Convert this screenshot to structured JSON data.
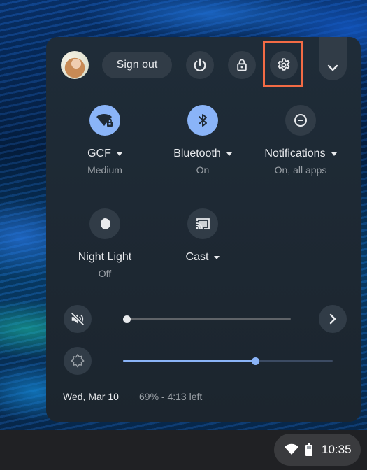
{
  "top_row": {
    "avatar_alt": "User avatar",
    "sign_out_label": "Sign out",
    "power_icon": "power-icon",
    "lock_icon": "lock-icon",
    "settings_icon": "gear-icon",
    "collapse_icon": "chevron-down-icon"
  },
  "tiles": [
    {
      "label": "GCF",
      "sub": "Medium",
      "icon": "wifi-lock-icon",
      "active": true,
      "has_menu": true
    },
    {
      "label": "Bluetooth",
      "sub": "On",
      "icon": "bluetooth-icon",
      "active": true,
      "has_menu": true
    },
    {
      "label": "Notifications",
      "sub": "On, all apps",
      "icon": "do-not-disturb-icon",
      "active": false,
      "has_menu": true
    },
    {
      "label": "Night Light",
      "sub": "Off",
      "icon": "night-light-icon",
      "active": false,
      "has_menu": false
    },
    {
      "label": "Cast",
      "sub": "",
      "icon": "cast-icon",
      "active": false,
      "has_menu": true
    }
  ],
  "sliders": {
    "volume": {
      "icon": "volume-muted-icon",
      "value": 0,
      "muted": true
    },
    "brightness": {
      "icon": "brightness-icon",
      "value": 0.63
    }
  },
  "footer": {
    "date": "Wed, Mar 10",
    "battery": "69% - 4:13 left"
  },
  "shelf": {
    "time": "10:35",
    "wifi_icon": "wifi-icon",
    "battery_icon": "battery-icon"
  },
  "colors": {
    "accent": "#8ab4f8",
    "highlight": "#f26b45",
    "panel": "#1f2a35"
  }
}
